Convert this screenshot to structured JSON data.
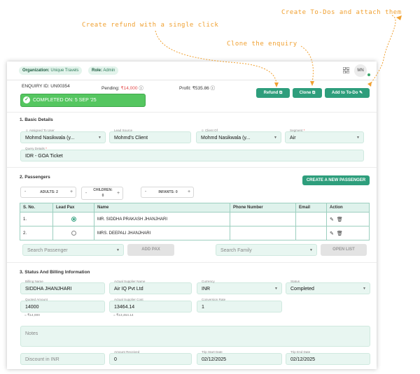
{
  "annotations": {
    "create_todos": "Create To-Dos and attach them",
    "create_refund": "Create refund with a single click",
    "clone": "Clone the enquiry"
  },
  "colors": {
    "accent": "#2e9e7c",
    "annotation": "#f0a030",
    "success": "#55c660",
    "field_bg": "#e8f6f1"
  },
  "topbar": {
    "org_label": "Organization:",
    "org_value": "Unique Travels",
    "role_label": "Role:",
    "role_value": "Admin",
    "avatar": "MN",
    "grid_icon": "apps-grid-icon"
  },
  "enquiry": {
    "id": "ENQUIRY ID: UN00354",
    "pending_label": "Pending:",
    "pending_value": "₹14,000",
    "profit": "Profit: ₹535.86",
    "completed": "COMPLETED ON: 5 SEP '25"
  },
  "actions": {
    "refund": "Refund",
    "clone": "Clone",
    "todo": "Add to To-Do"
  },
  "basic": {
    "title": "1. Basic Details",
    "assigned_label": "Assigned To User",
    "assigned_value": "Mohmd Nasikwala (y...",
    "lead_label": "Lead Source",
    "lead_value": "Mohmd's Client",
    "client_label": "Client Of",
    "client_value": "Mohmd Nasikwala (y...",
    "segment_label": "Segment",
    "segment_value": "Air",
    "query_label": "Query Details",
    "query_value": "IDR - GOA Ticket"
  },
  "passengers": {
    "title": "2. Passengers",
    "create_btn": "CREATE A NEW PASSENGER",
    "adults": "ADULTS: 2",
    "children_label": "CHILDREN:",
    "children_value": "0",
    "infants": "INFANTS: 0",
    "minus": "-",
    "plus": "+",
    "headers": [
      "S. No.",
      "Lead Pax",
      "Name",
      "Phone Number",
      "Email",
      "Action"
    ],
    "rows": [
      {
        "sno": "1.",
        "lead": true,
        "name": "MR. SIDDHA PRAKASH JHANJHARI",
        "phone": "",
        "email": ""
      },
      {
        "sno": "2.",
        "lead": false,
        "name": "MRS. DEEPALI JHANJHARI",
        "phone": "",
        "email": ""
      }
    ],
    "search_pax": "Search Passenger",
    "add_pax": "ADD PAX",
    "search_family": "Search Family",
    "open_list": "OPEN LIST"
  },
  "billing": {
    "title": "3. Status And Billing Information",
    "billing_name_label": "Billing Name",
    "billing_name": "SIDDHA JHANJHARI",
    "supplier_label": "Actual Supplier Name",
    "supplier": "Air IQ Pvt Ltd",
    "currency_label": "Currency",
    "currency": "INR",
    "status_label": "Status",
    "status": "Completed",
    "quoted_label": "Quoted Amount",
    "quoted": "14000",
    "quoted_under": "= ₹14,000",
    "cost_label": "Actual Supplier Cost",
    "cost": "13464.14",
    "cost_under": "= ₹13,464.14",
    "rate_label": "Conversion Rate",
    "rate": "1",
    "notes": "Notes",
    "discount": "Discount in INR",
    "received_label": "Amount Received",
    "received": "0",
    "start_label": "Trip Start Date",
    "start": "02/12/2025",
    "end_label": "Trip End Date",
    "end": "02/12/2025"
  }
}
